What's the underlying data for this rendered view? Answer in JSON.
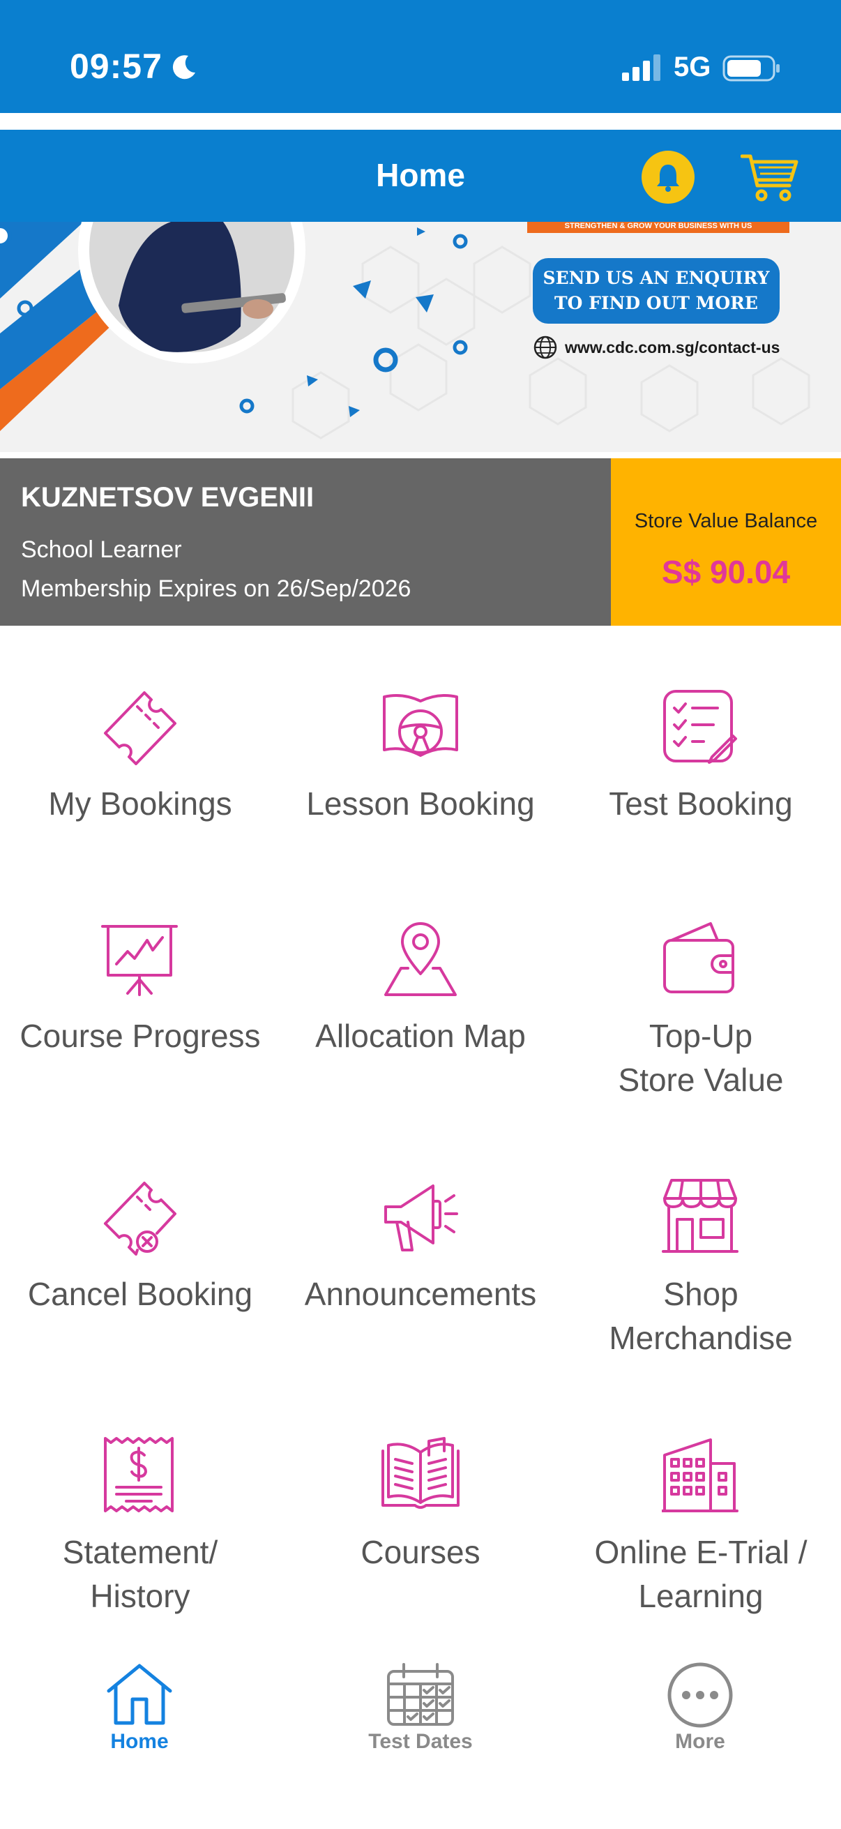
{
  "status": {
    "time": "09:57",
    "network": "5G"
  },
  "header": {
    "title": "Home"
  },
  "banner": {
    "strip_text": "STRENGTHEN & GROW YOUR BUSINESS WITH US",
    "enquiry_line1": "SEND US AN ENQUIRY",
    "enquiry_line2": "TO FIND OUT MORE",
    "website": "www.cdc.com.sg/contact-us"
  },
  "profile": {
    "name": "KUZNETSOV EVGENII",
    "role": "School Learner",
    "expiry": "Membership Expires on 26/Sep/2026"
  },
  "store": {
    "label": "Store Value Balance",
    "amount": "S$ 90.04"
  },
  "menu": [
    {
      "label": "My Bookings",
      "icon": "ticket-icon"
    },
    {
      "label": "Lesson Booking",
      "icon": "steering-book-icon"
    },
    {
      "label": "Test Booking",
      "icon": "checklist-icon"
    },
    {
      "label": "Course Progress",
      "icon": "presentation-chart-icon"
    },
    {
      "label": "Allocation Map",
      "icon": "map-pin-icon"
    },
    {
      "label": "Top-Up\nStore Value",
      "icon": "wallet-icon"
    },
    {
      "label": "Cancel Booking",
      "icon": "ticket-cancel-icon"
    },
    {
      "label": "Announcements",
      "icon": "megaphone-icon"
    },
    {
      "label": "Shop\nMerchandise",
      "icon": "storefront-icon"
    },
    {
      "label": "Statement/\nHistory",
      "icon": "receipt-icon"
    },
    {
      "label": "Courses",
      "icon": "open-book-icon"
    },
    {
      "label": "Online E-Trial /\nLearning",
      "icon": "building-icon"
    }
  ],
  "tabs": [
    {
      "label": "Home",
      "icon": "home-icon",
      "active": true
    },
    {
      "label": "Test Dates",
      "icon": "calendar-icon",
      "active": false
    },
    {
      "label": "More",
      "icon": "more-icon",
      "active": false
    }
  ],
  "colors": {
    "brand_blue": "#0A7FCF",
    "accent_magenta": "#D6399E",
    "store_yellow": "#FFB300",
    "profile_gray": "#666666"
  }
}
